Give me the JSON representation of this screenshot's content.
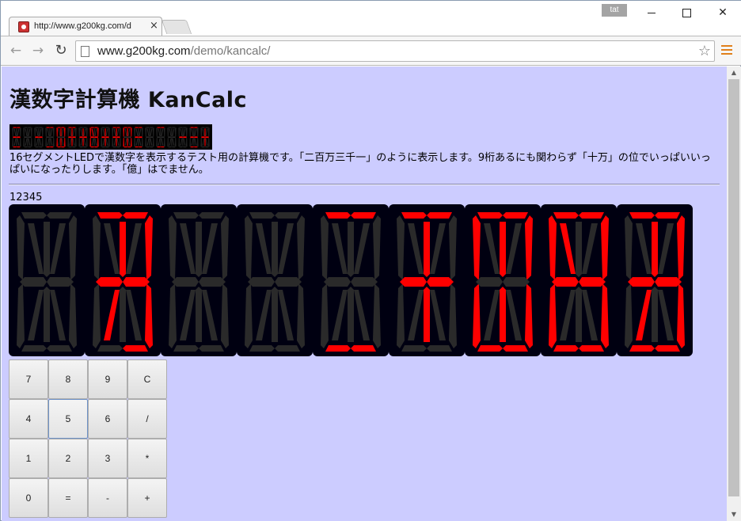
{
  "browser": {
    "tab_title": "http://www.g200kg.com/d",
    "tab_close": "×",
    "user_badge": "tat",
    "url_host": "www.g200kg.com",
    "url_path": "/demo/kancalc/",
    "back_glyph": "←",
    "forward_glyph": "→",
    "reload_glyph": "↻",
    "star_glyph": "☆",
    "close_glyph": "✕",
    "icons": [
      "favicon-icon",
      "back-arrow-icon",
      "forward-arrow-icon",
      "reload-icon",
      "page-icon",
      "bookmark-star-icon",
      "menu-icon",
      "minimize-icon",
      "maximize-icon",
      "close-icon"
    ]
  },
  "page": {
    "title": "漢数字計算機 KanCalc",
    "description": "16セグメントLEDで漢数字を表示するテスト用の計算機です。「二百万三千一」のように表示します。9桁あるにも関わらず「十万」の位でいっぱいいっぱいになったりします。「億」はでません。",
    "current_value": "12345",
    "display_digits": [
      "",
      "万",
      "",
      "",
      "二",
      "千",
      "四",
      "百",
      "五"
    ]
  },
  "colors": {
    "page_background": "#ccccff",
    "led_on": "#ff0000",
    "led_off": "#2a2a2a",
    "display_background": "#000011"
  },
  "keypad": {
    "rows": [
      [
        "7",
        "8",
        "9",
        "C"
      ],
      [
        "4",
        "5",
        "6",
        "/"
      ],
      [
        "1",
        "2",
        "3",
        "*"
      ],
      [
        "0",
        "=",
        "-",
        "+"
      ]
    ],
    "focused_key": "5"
  }
}
